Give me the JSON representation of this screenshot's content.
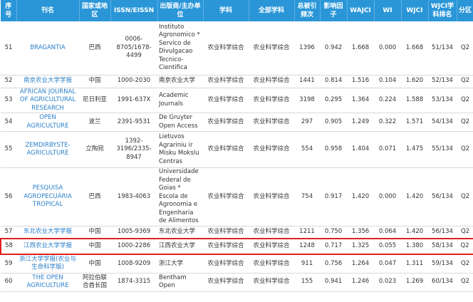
{
  "headers": [
    "序号",
    "刊名",
    "国家或地区",
    "ISSN/EISSN",
    "出版商/主办单位",
    "学科",
    "全部学科",
    "总被引频次",
    "影响因子",
    "WAJCI",
    "WI",
    "WJCI",
    "WJCI学科排名",
    "分区"
  ],
  "rows": [
    [
      "51",
      "BRAGANTIA",
      "巴西",
      "0006-8705/1678-4499",
      "Instituto Agronomico * Servico de Divulgacao Tecnico-Cientifica",
      "农业科学综合",
      "农业科学综合",
      "1396",
      "0.942",
      "1.668",
      "0.000",
      "1.668",
      "51/134",
      "Q2"
    ],
    [
      "52",
      "南京农业大学学报",
      "中国",
      "1000-2030",
      "南京农业大学",
      "农业科学综合",
      "农业科学综合",
      "1441",
      "0.814",
      "1.516",
      "0.104",
      "1.620",
      "52/134",
      "Q2"
    ],
    [
      "53",
      "AFRICAN JOURNAL OF AGRICULTURAL RESEARCH",
      "尼日利亚",
      "1991-637X",
      "Academic Journals",
      "农业科学综合",
      "农业科学综合",
      "3198",
      "0.295",
      "1.364",
      "0.224",
      "1.588",
      "53/134",
      "Q2"
    ],
    [
      "54",
      "OPEN AGRICULTURE",
      "波兰",
      "2391-9531",
      "De Gruyter Open Access",
      "农业科学综合",
      "农业科学综合",
      "297",
      "0.905",
      "1.249",
      "0.322",
      "1.571",
      "54/134",
      "Q2"
    ],
    [
      "55",
      "ZEMDIRBYSTE-AGRICULTURE",
      "立陶宛",
      "1392-3196/2335-8947",
      "Lietuvos Agrariniu ir Misku Mokslu Centras",
      "农业科学综合",
      "农业科学综合",
      "554",
      "0.958",
      "1.404",
      "0.071",
      "1.475",
      "55/134",
      "Q2"
    ],
    [
      "56",
      "PESQUISA AGROPECUÁRIA TROPICAL",
      "巴西",
      "1983-4063",
      "Universidade Federal de Goias * Escola de Agronomia e Engenharia de Alimentos",
      "农业科学综合",
      "农业科学综合",
      "754",
      "0.917",
      "1.420",
      "0.000",
      "1.420",
      "56/134",
      "Q2"
    ],
    [
      "57",
      "东北农业大学学报",
      "中国",
      "1005-9369",
      "东北农业大学",
      "农业科学综合",
      "农业科学综合",
      "1211",
      "0.750",
      "1.356",
      "0.064",
      "1.420",
      "56/134",
      "Q2"
    ],
    [
      "58",
      "江西农业大学学报",
      "中国",
      "1000-2286",
      "江西农业大学",
      "农业科学综合",
      "农业科学综合",
      "1248",
      "0.717",
      "1.325",
      "0.055",
      "1.380",
      "58/134",
      "Q2"
    ],
    [
      "59",
      "浙江大学学报(农业与生命科学版)",
      "中国",
      "1008-9209",
      "浙江大学",
      "农业科学综合",
      "农业科学综合",
      "911",
      "0.756",
      "1.264",
      "0.047",
      "1.311",
      "59/134",
      "Q2"
    ],
    [
      "60",
      "THE OPEN AGRICULTURE",
      "阿拉伯联合酋长国",
      "1874-3315",
      "Bentham Open",
      "农业科学综合",
      "农业科学综合",
      "155",
      "0.941",
      "1.246",
      "0.023",
      "1.269",
      "60/134",
      "Q2"
    ]
  ],
  "highlight_row": 7
}
